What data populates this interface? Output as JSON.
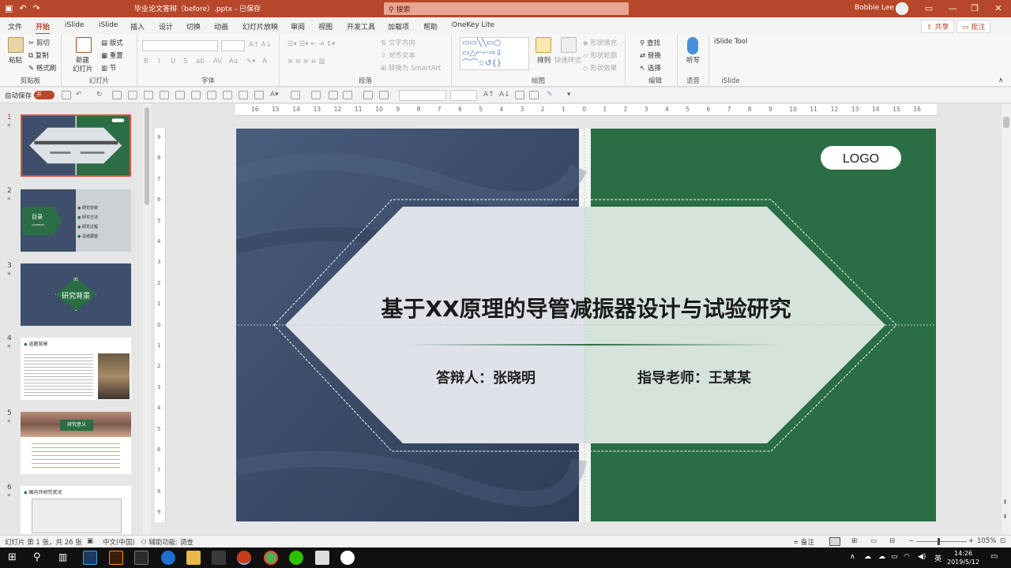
{
  "titlebar": {
    "doc_title": "毕业论文答辩（before）.pptx - 已保存",
    "search_placeholder": "搜索",
    "user": "Bobbie Lee",
    "min": "—",
    "restore": "❐",
    "close": "✕"
  },
  "tabs": {
    "file": "文件",
    "items": [
      "开始",
      "iSlide",
      "iSlide",
      "插入",
      "设计",
      "切换",
      "动画",
      "幻灯片放映",
      "审阅",
      "视图",
      "开发工具",
      "加载项",
      "帮助",
      "OneKey Lite"
    ],
    "active_index": 0,
    "share": "共享",
    "comment": "批注"
  },
  "ribbon": {
    "clipboard": {
      "label": "剪贴板",
      "paste": "粘贴",
      "cut": "剪切",
      "copy": "复制",
      "format_painter": "格式刷"
    },
    "slides": {
      "label": "幻灯片",
      "new_slide_1": "新建",
      "new_slide_2": "幻灯片",
      "layout": "版式",
      "reset": "重置",
      "section": "节"
    },
    "font": {
      "label": "字体",
      "buttons": [
        "B",
        "I",
        "U",
        "S",
        "ab",
        "AV",
        "Aa",
        "A"
      ]
    },
    "paragraph": {
      "label": "段落",
      "text_direction": "文字方向",
      "align_text": "对齐文本",
      "smartart": "转换为 SmartArt"
    },
    "drawing": {
      "label": "绘图",
      "arrange": "排列",
      "quick_styles": "快速样式",
      "shape_fill": "形状填充",
      "shape_outline": "形状轮廓",
      "shape_effects": "形状效果"
    },
    "editing": {
      "label": "编辑",
      "find": "查找",
      "replace": "替换",
      "select": "选择"
    },
    "voice": {
      "label": "语音",
      "dictate": "听写"
    },
    "islide": {
      "label": "iSlide",
      "tool": "iSlide Tool"
    }
  },
  "qabar": {
    "autosave": "自动保存",
    "toggle": "开"
  },
  "thumbnails": {
    "numbers": [
      "1",
      "2",
      "3",
      "4",
      "5",
      "6"
    ],
    "t2_title": "目录",
    "t2_sub": "CONTENTS",
    "t2_items": [
      "研究背景",
      "研究方法",
      "研究过程",
      "总结展望"
    ],
    "t3_num": "01",
    "t3_title": "研究背景",
    "t4_title": "选题背景",
    "t5_title": "研究意义",
    "t6_title": "国内外研究状况"
  },
  "ruler": {
    "h_ticks": [
      "16",
      "15",
      "14",
      "13",
      "12",
      "11",
      "10",
      "9",
      "8",
      "7",
      "6",
      "5",
      "4",
      "3",
      "2",
      "1",
      "0",
      "1",
      "2",
      "3",
      "4",
      "5",
      "6",
      "7",
      "8",
      "9",
      "10",
      "11",
      "12",
      "13",
      "14",
      "15",
      "16"
    ],
    "v_ticks": [
      "9",
      "8",
      "7",
      "6",
      "5",
      "4",
      "3",
      "2",
      "1",
      "0",
      "1",
      "2",
      "3",
      "4",
      "5",
      "6",
      "7",
      "8",
      "9"
    ]
  },
  "slide": {
    "logo": "LOGO",
    "title": "基于XX原理的导管减振器设计与试验研究",
    "defender": "答辩人：张晓明",
    "advisor": "指导老师：王某某",
    "colors": {
      "green": "#2b6e45",
      "navy": "#3d4f6b",
      "panel_left": "#d8dde4",
      "panel_right": "#d3e2d8"
    }
  },
  "statusbar": {
    "slide_info": "幻灯片 第 1 张，共 26 张",
    "language": "中文(中国)",
    "accessibility": "辅助功能: 调查",
    "notes": "备注",
    "zoom": "105%"
  },
  "taskbar": {
    "time": "14:26",
    "date": "2019/5/12",
    "ime": "英"
  }
}
